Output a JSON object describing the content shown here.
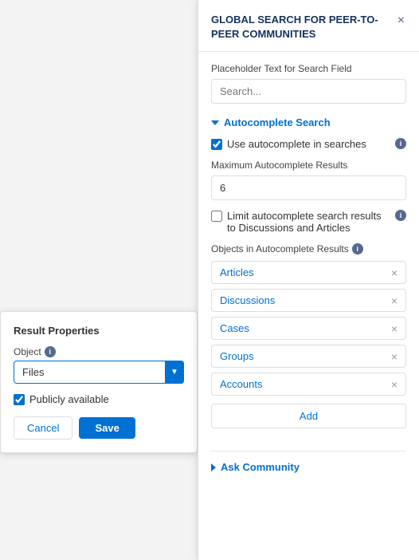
{
  "right_panel": {
    "title": "GLOBAL SEARCH FOR PEER-TO-PEER COMMUNITIES",
    "close_label": "×",
    "search_section": {
      "placeholder_label": "Placeholder Text for Search Field",
      "search_placeholder": "Search..."
    },
    "autocomplete_section": {
      "title": "Autocomplete Search",
      "use_autocomplete_label": "Use autocomplete in searches",
      "max_results_label": "Maximum Autocomplete Results",
      "max_results_value": "6",
      "limit_label": "Limit autocomplete search results to Discussions and Articles",
      "objects_label": "Objects in Autocomplete Results",
      "objects": [
        {
          "name": "Articles"
        },
        {
          "name": "Discussions"
        },
        {
          "name": "Cases"
        },
        {
          "name": "Groups"
        },
        {
          "name": "Accounts"
        }
      ],
      "add_button_label": "Add"
    },
    "ask_community_section": {
      "title": "Ask Community"
    }
  },
  "left_panel": {
    "title": "Result Properties",
    "object_label": "Object",
    "object_value": "Files",
    "publicly_available_label": "Publicly available",
    "cancel_label": "Cancel",
    "save_label": "Save"
  },
  "icons": {
    "info": "ℹ",
    "close": "×",
    "check": "✓"
  }
}
